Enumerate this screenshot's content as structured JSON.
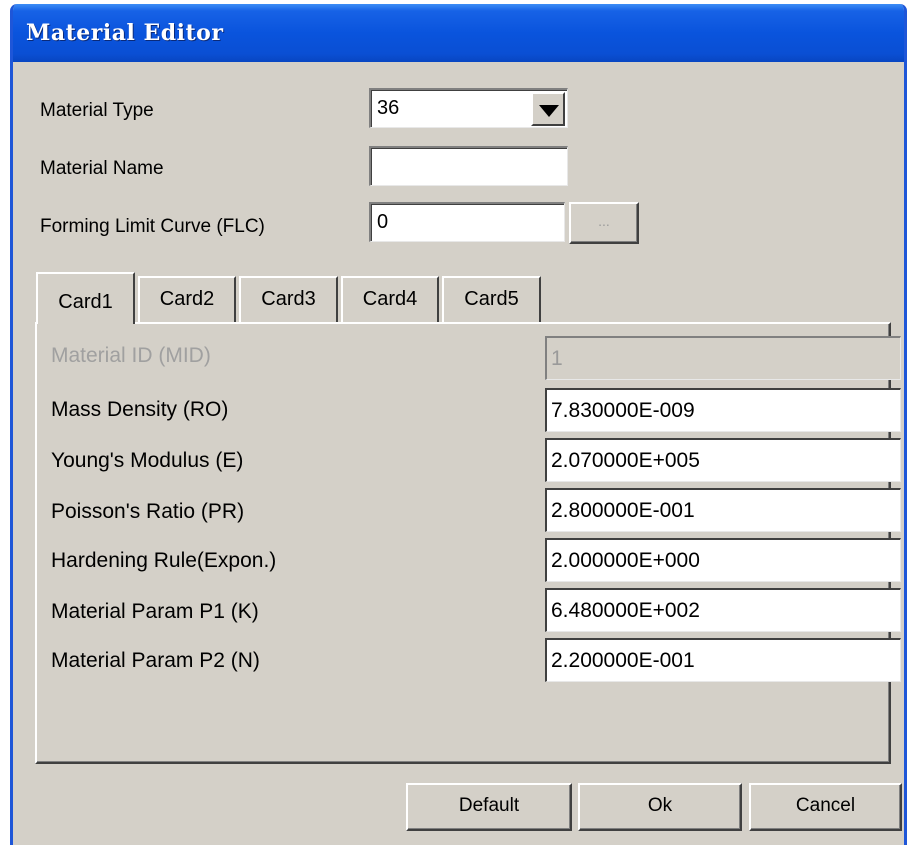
{
  "window": {
    "title": "Material Editor"
  },
  "header": {
    "material_type_label": "Material Type",
    "material_type_value": "36",
    "material_name_label": "Material Name",
    "material_name_value": "",
    "flc_label": "Forming Limit Curve (FLC)",
    "flc_value": "0",
    "flc_browse_label": "..."
  },
  "tabs": [
    {
      "label": "Card1",
      "active": true
    },
    {
      "label": "Card2",
      "active": false
    },
    {
      "label": "Card3",
      "active": false
    },
    {
      "label": "Card4",
      "active": false
    },
    {
      "label": "Card5",
      "active": false
    }
  ],
  "card1": {
    "fields": [
      {
        "label": "Material ID (MID)",
        "value": "1",
        "disabled": true
      },
      {
        "label": "Mass Density (RO)",
        "value": "7.830000E-009",
        "disabled": false
      },
      {
        "label": "Young's Modulus (E)",
        "value": "2.070000E+005",
        "disabled": false
      },
      {
        "label": "Poisson's Ratio (PR)",
        "value": "2.800000E-001",
        "disabled": false
      },
      {
        "label": "Hardening Rule(Expon.)",
        "value": "2.000000E+000",
        "disabled": false
      },
      {
        "label": "Material Param P1 (K)",
        "value": "6.480000E+002",
        "disabled": false
      },
      {
        "label": "Material Param P2 (N)",
        "value": "2.200000E-001",
        "disabled": false
      }
    ]
  },
  "buttons": {
    "default_label": "Default",
    "ok_label": "Ok",
    "cancel_label": "Cancel"
  },
  "colors": {
    "titlebar": "#0a54dd",
    "dialog_bg": "#d4d0c8",
    "border_blue": "#1e56d8"
  }
}
